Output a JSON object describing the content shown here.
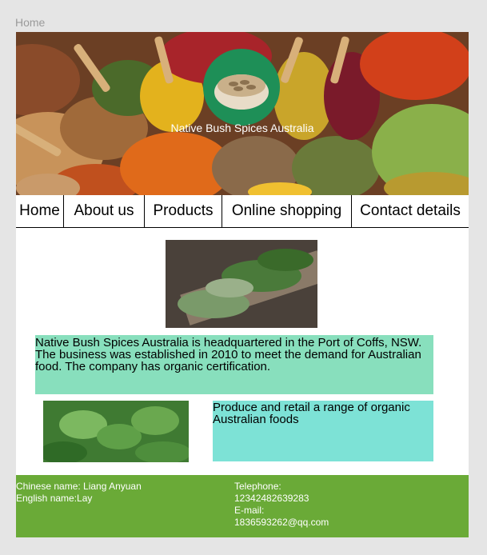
{
  "frame": {
    "label": "Home"
  },
  "banner": {
    "title": "Native Bush Spices Australia",
    "image": "spice-market-photo",
    "logo": "bowl-of-seeds-logo"
  },
  "nav": {
    "items": [
      {
        "label": "Home"
      },
      {
        "label": "About us"
      },
      {
        "label": "Products"
      },
      {
        "label": "Online shopping"
      },
      {
        "label": "Contact details"
      }
    ]
  },
  "content": {
    "intro": {
      "line1": "Native Bush Spices Australia is headquartered in the Port of Coffs, NSW.",
      "line2": "The business was established in 2010 to meet the demand for Australian food. The company has organic certification."
    },
    "produce": "Produce and retail a range of organic Australian foods",
    "herbs_image": "fresh-herbs-photo",
    "mint_image": "mint-leaves-photo"
  },
  "footer": {
    "chinese_name": "Chinese name: Liang Anyuan",
    "english_name": "English name:Lay",
    "telephone_label": "Telephone:",
    "telephone": "12342482639283",
    "email_label": "E-mail:",
    "email": "1836593262@qq.com"
  },
  "colors": {
    "intro_bg": "#88dfbd",
    "produce_bg": "#7de2d6",
    "footer_bg": "#6aaa37",
    "logo_bg": "#1e8f57"
  }
}
